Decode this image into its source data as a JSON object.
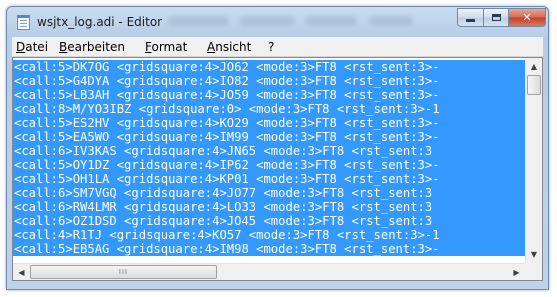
{
  "window": {
    "title": "wsjtx_log.adi - Editor"
  },
  "menu": {
    "items": [
      "Datei",
      "Bearbeiten",
      "Format",
      "Ansicht",
      "?"
    ]
  },
  "editor": {
    "selection_color": "#3399ff",
    "lines": [
      "<call:5>DK7OG <gridsquare:4>JO62 <mode:3>FT8 <rst_sent:3>-",
      "<call:5>G4DYA <gridsquare:4>IO82 <mode:3>FT8 <rst_sent:3>-",
      "<call:5>LB3AH <gridsquare:4>JO59 <mode:3>FT8 <rst_sent:3>-",
      "<call:8>M/YO3IBZ <gridsquare:0> <mode:3>FT8 <rst_sent:3>-1",
      "<call:5>ES2HV <gridsquare:4>KO29 <mode:3>FT8 <rst_sent:3>-",
      "<call:5>EA5WO <gridsquare:4>IM99 <mode:3>FT8 <rst_sent:3>-",
      "<call:6>IV3KAS <gridsquare:4>JN65 <mode:3>FT8 <rst_sent:3",
      "<call:5>OY1DZ <gridsquare:4>IP62 <mode:3>FT8 <rst_sent:3>-",
      "<call:5>OH1LA <gridsquare:4>KP01 <mode:3>FT8 <rst_sent:3>-",
      "<call:6>SM7VGQ <gridsquare:4>JO77 <mode:3>FT8 <rst_sent:3",
      "<call:6>RW4LMR <gridsquare:4>LO33 <mode:3>FT8 <rst_sent:3",
      "<call:6>OZ1DSD <gridsquare:4>JO45 <mode:3>FT8 <rst_sent:3",
      "<call:4>R1TJ <gridsquare:4>KO57 <mode:3>FT8 <rst_sent:3>-1",
      "<call:5>EB5AG <gridsquare:4>IM98 <mode:3>FT8 <rst_sent:3>-"
    ]
  },
  "scrollbar": {
    "up_arrow": "▲",
    "down_arrow": "▼",
    "left_arrow": "◀",
    "right_arrow": "▶",
    "grip": "III"
  }
}
